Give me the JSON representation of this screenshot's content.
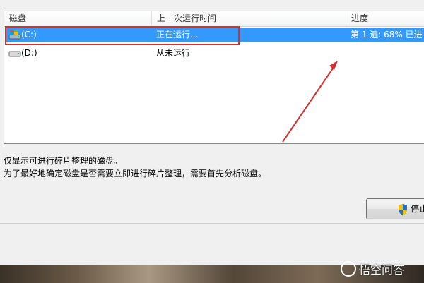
{
  "columns": {
    "disk": "磁盘",
    "last_run": "上一次运行时间",
    "progress": "进度"
  },
  "disks": [
    {
      "name": "(C:)",
      "last_run": "正在运行...",
      "progress": "第 1 遍: 68% 已进",
      "selected": true,
      "icon": "system-drive-icon"
    },
    {
      "name": "(D:)",
      "last_run": "从未运行",
      "progress": "",
      "selected": false,
      "icon": "hard-drive-icon"
    }
  ],
  "info": {
    "line1": "仅显示可进行碎片整理的磁盘。",
    "line2": "为了最好地确定磁盘是否需要立即进行碎片整理，需要首先分析磁盘。"
  },
  "buttons": {
    "stop_label": "停止"
  },
  "watermark": {
    "text": "悟空问答"
  },
  "colors": {
    "selection": "#3399ff",
    "annotation": "#d32f2f"
  }
}
